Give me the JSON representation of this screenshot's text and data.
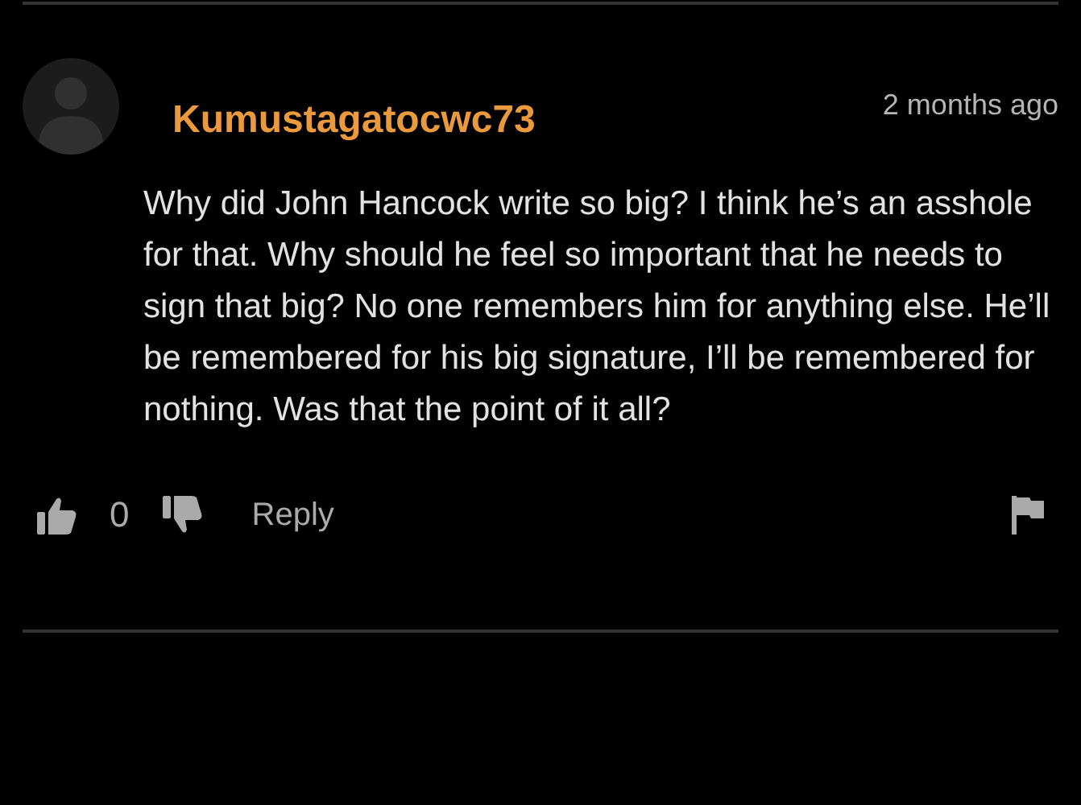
{
  "comment": {
    "username": "Kumustagatocwc73",
    "time": "2 months ago",
    "body": "Why did John Hancock write so big? I think he’s an asshole for that. Why should he feel so important that he needs to sign that big? No one remembers him for anything else. He’ll be remembered for his big signature, I’ll be remembered for nothing. Was that the point of it all?",
    "votes": "0",
    "reply": "Reply"
  }
}
